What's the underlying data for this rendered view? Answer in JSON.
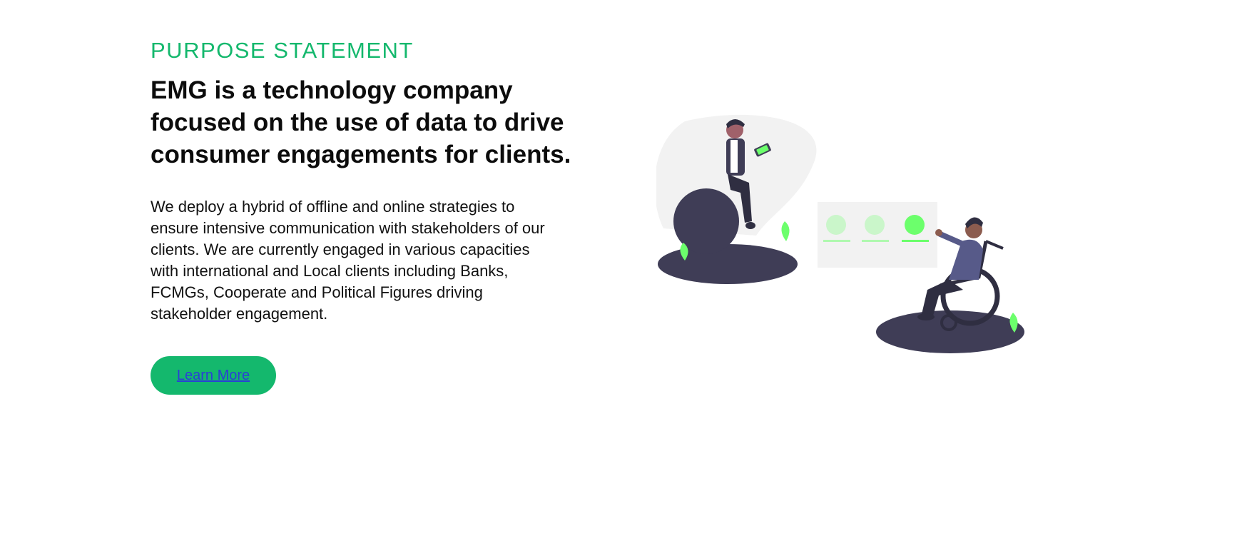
{
  "purpose": {
    "eyebrow": "PURPOSE STATEMENT",
    "headline": "EMG is a technology company focused on the use of data to drive consumer engagements for clients.",
    "body": "We deploy a hybrid of offline and online strategies to ensure intensive communication with stakeholders of our clients. We are currently engaged in various capacities with international and Local clients including Banks, FCMGs, Cooperate and Political Figures driving stakeholder engagement.",
    "cta_label": "Learn More"
  },
  "colors": {
    "accent": "#14b86d",
    "dark": "#3f3d56",
    "leaf": "#6cff6c",
    "panel": "#f2f2f2"
  },
  "illustration": {
    "icon": "people-engagement-illustration"
  }
}
